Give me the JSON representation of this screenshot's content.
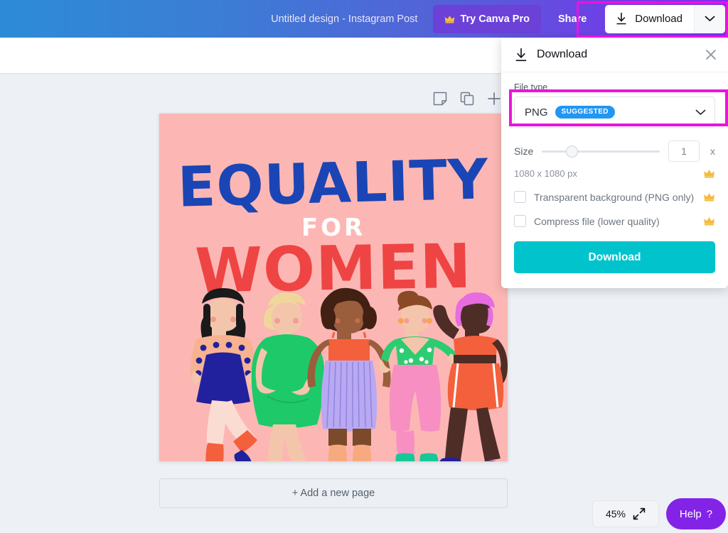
{
  "topbar": {
    "doc_title": "Untitled design - Instagram Post",
    "pro_button": "Try Canva Pro",
    "share_button": "Share",
    "download_button": "Download",
    "crown_icon": "crown-icon",
    "download_icon": "download-arrow-icon",
    "caret_icon": "chevron-down-icon",
    "gradient_start": "#2d8bd6",
    "gradient_end": "#7b2ff2",
    "highlight_color": "#ec13dd"
  },
  "page_tools": {
    "notes_icon": "sticky-note-icon",
    "duplicate_icon": "duplicate-page-icon",
    "add_icon": "plus-icon"
  },
  "canvas": {
    "add_page_label": "+ Add a new page",
    "design": {
      "background": "#fcb7b4",
      "line1": "EQUALITY",
      "line1_color": "#1b45b4",
      "line2": "FOR",
      "line2_color": "#ffffff",
      "line3": "WOMEN",
      "line3_color": "#ef4444",
      "figures": [
        {
          "name": "woman-polka-dot-skirt",
          "hair": "#1a1a1a",
          "top": "#f6b59a",
          "bottom": "#21219e",
          "shoe": "#21219e"
        },
        {
          "name": "woman-green-dress",
          "hair": "#efd79b",
          "top": "#1ec96a",
          "bottom": "#1ec96a",
          "shoe": "#f5249b"
        },
        {
          "name": "woman-striped-pants",
          "hair": "#432014",
          "top": "#f4603c",
          "bottom": "#b9a8f2",
          "shoe": "#f7a97f"
        },
        {
          "name": "woman-pink-pants",
          "hair": "#8a4a26",
          "top": "#2ecc71",
          "bottom": "#f78fc2",
          "shoe": "#16c79a"
        },
        {
          "name": "woman-coral-sportswear",
          "hair": "#e66ce0",
          "top": "#f4603c",
          "bottom": "#f4603c",
          "shoe": "#21219e"
        }
      ]
    }
  },
  "bottom": {
    "zoom_level": "45%",
    "expand_icon": "fullscreen-expand-icon",
    "help_label": "Help",
    "help_mark": "?"
  },
  "download_panel": {
    "title": "Download",
    "title_icon": "download-arrow-icon",
    "close_icon": "close-x-icon",
    "file_type_label": "File type",
    "file_type_value": "PNG",
    "file_type_badge": "SUGGESTED",
    "badge_color": "#2196f3",
    "dropdown_icon": "chevron-down-icon",
    "size_label": "Size",
    "size_value": "1",
    "size_unit": "x",
    "size_slider_percent": 25,
    "dimensions": "1080 x 1080 px",
    "checkbox_transparent": "Transparent background (PNG only)",
    "checkbox_compress": "Compress file (lower quality)",
    "crown_icon": "crown-icon",
    "cta_label": "Download",
    "cta_color": "#00c3cc",
    "highlight_color": "#ec13dd"
  }
}
